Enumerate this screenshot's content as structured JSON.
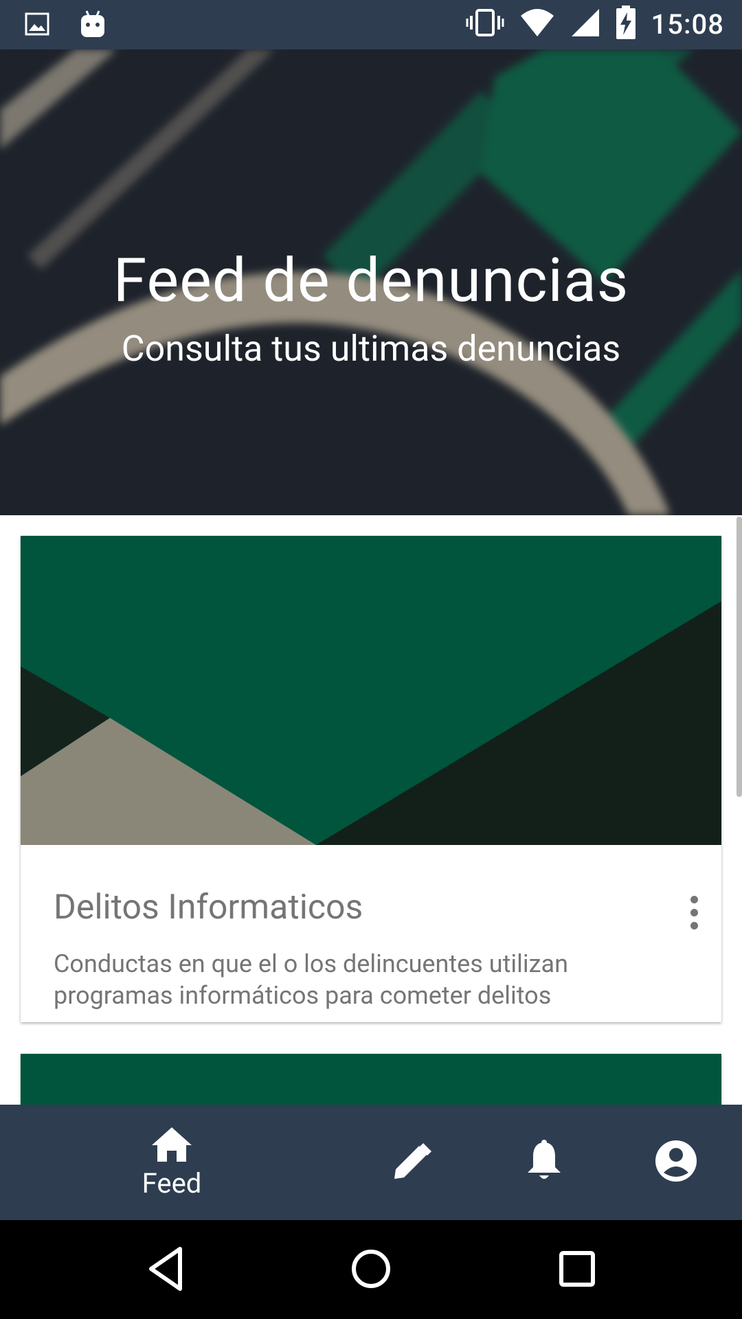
{
  "status_bar": {
    "time": "15:08",
    "left_icons": [
      "image-icon",
      "android-icon"
    ],
    "right_icons": [
      "vibrate-icon",
      "wifi-icon",
      "signal-icon",
      "battery-charging-icon"
    ]
  },
  "hero": {
    "title": "Feed de denuncias",
    "subtitle": "Consulta tus ultimas denuncias"
  },
  "cards": [
    {
      "title": "Delitos Informaticos",
      "description": "Conductas en que el o los delincuentes utilizan programas informáticos para cometer delitos",
      "menu_icon": "more-vert-icon"
    }
  ],
  "bottom_nav": {
    "items": [
      {
        "label": "Feed",
        "icon": "home-icon",
        "active": true
      },
      {
        "label": "",
        "icon": "edit-icon",
        "active": false
      },
      {
        "label": "",
        "icon": "bell-icon",
        "active": false
      },
      {
        "label": "",
        "icon": "account-circle-icon",
        "active": false
      }
    ]
  },
  "system_nav": [
    "back-icon",
    "home-circle-icon",
    "recents-icon"
  ],
  "colors": {
    "primary_dark": "#2e3d50",
    "hero_bg": "#1e232b",
    "accent_green": "#00553c",
    "text_gray": "#757575"
  }
}
